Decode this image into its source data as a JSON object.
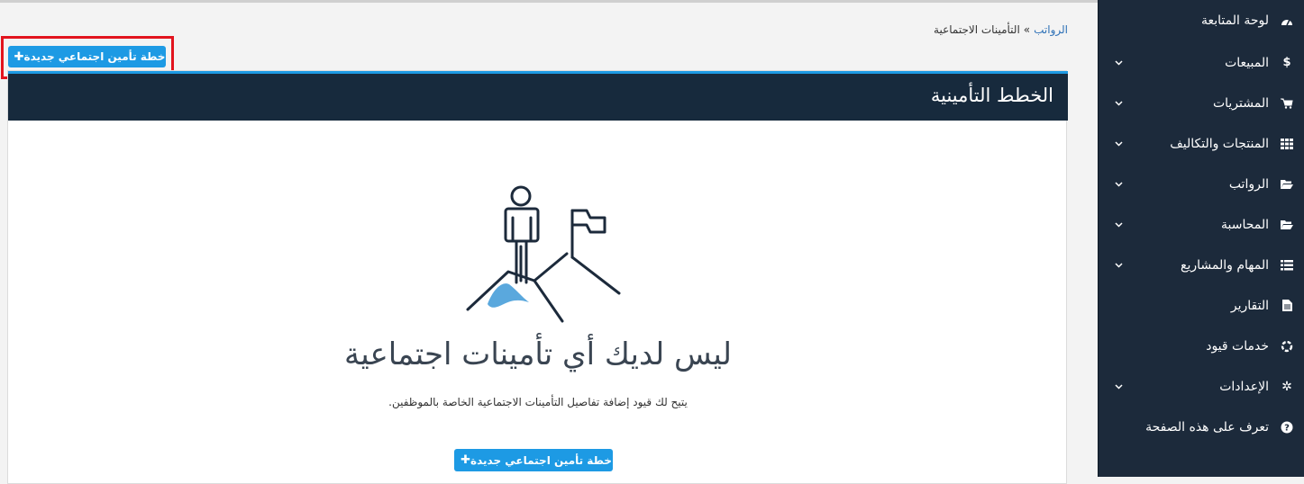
{
  "sidebar": {
    "items": [
      {
        "label": "لوحة المتابعة",
        "icon": "dashboard-icon",
        "has_chevron": false
      },
      {
        "label": "المبيعات",
        "icon": "dollar-icon",
        "has_chevron": true
      },
      {
        "label": "المشتريات",
        "icon": "cart-icon",
        "has_chevron": true
      },
      {
        "label": "المنتجات والتكاليف",
        "icon": "grid-icon",
        "has_chevron": true
      },
      {
        "label": "الرواتب",
        "icon": "folder-icon",
        "has_chevron": true
      },
      {
        "label": "المحاسبة",
        "icon": "folder-icon",
        "has_chevron": true
      },
      {
        "label": "المهام والمشاريع",
        "icon": "list-icon",
        "has_chevron": true
      },
      {
        "label": "التقارير",
        "icon": "file-icon",
        "has_chevron": false
      },
      {
        "label": "خدمات قيود",
        "icon": "puzzle-icon",
        "has_chevron": false
      },
      {
        "label": "الإعدادات",
        "icon": "gear-icon",
        "has_chevron": true
      },
      {
        "label": "تعرف على هذه الصفحة",
        "icon": "help-icon",
        "has_chevron": false
      }
    ]
  },
  "breadcrumb": {
    "link": "الرواتب",
    "separator": "»",
    "current": "التأمينات الاجتماعية"
  },
  "toolbar": {
    "add_label": "خطة تأمين اجتماعي جديدة",
    "plus_glyph": "✚"
  },
  "card": {
    "title": "الخطط التأمينية"
  },
  "empty_state": {
    "title": "ليس لديك أي تأمينات اجتماعية",
    "description": "يتيح لك قيود إضافة تفاصيل التأمينات الاجتماعية الخاصة بالموظفين.",
    "button_label": "خطة تأمين اجتماعي جديدة"
  },
  "colors": {
    "sidebar_bg": "#1c2a3b",
    "header_bg": "#172a3d",
    "accent": "#1d9ae4",
    "highlight": "#e2141e",
    "illustration_fill": "#5aa8dd"
  }
}
